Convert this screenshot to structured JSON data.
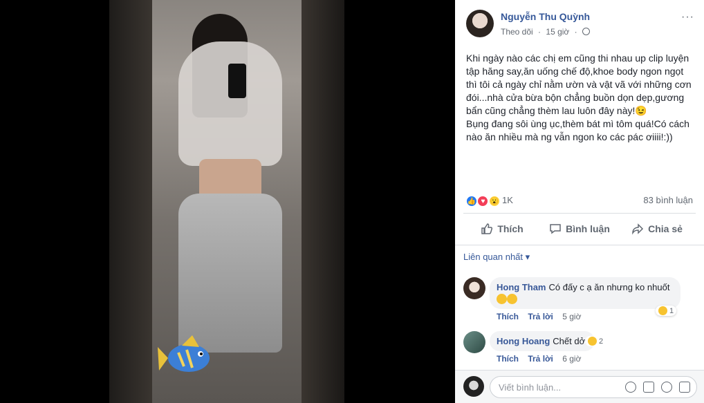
{
  "post": {
    "author": "Nguyễn Thu Quỳnh",
    "follow": "Theo dõi",
    "time": "15 giờ",
    "more": "···",
    "text": "Khi ngày nào các chị em cũng thi nhau up clip luyện tập hăng say,ăn uống chế độ,khoe body ngon ngọt thì tôi cả ngày chỉ nằm ườn và vật vã với những cơn đói...nhà cửa bừa bộn chẳng buồn dọn dẹp,gương bẩn cũng chẳng thèm lau luôn đây này!😉\nBụng đang sôi ùng ục,thèm bát mì tôm quá!Có cách nào ăn nhiều mà ng vẫn ngon ko các pác ơiiii!:))",
    "reaction_count": "1K",
    "comment_count": "83 bình luận"
  },
  "actions": {
    "like": "Thích",
    "comment": "Bình luận",
    "share": "Chia sẻ"
  },
  "comments_sort": "Liên quan nhất",
  "comments": [
    {
      "name": "Hong Tham",
      "text": "Có đấy c ạ ăn nhưng ko nhuốt",
      "like": "Thích",
      "reply": "Trả lời",
      "time": "5 giờ",
      "reactions": "1"
    },
    {
      "name": "Hong Hoang",
      "text": "Chết dở.",
      "like": "Thích",
      "reply": "Trả lời",
      "time": "6 giờ",
      "reactions": "2"
    }
  ],
  "write_comment": {
    "placeholder": "Viết bình luận..."
  },
  "colors": {
    "link": "#365899",
    "like": "#2078f4",
    "love": "#f33e58",
    "wow": "#fcd440"
  }
}
